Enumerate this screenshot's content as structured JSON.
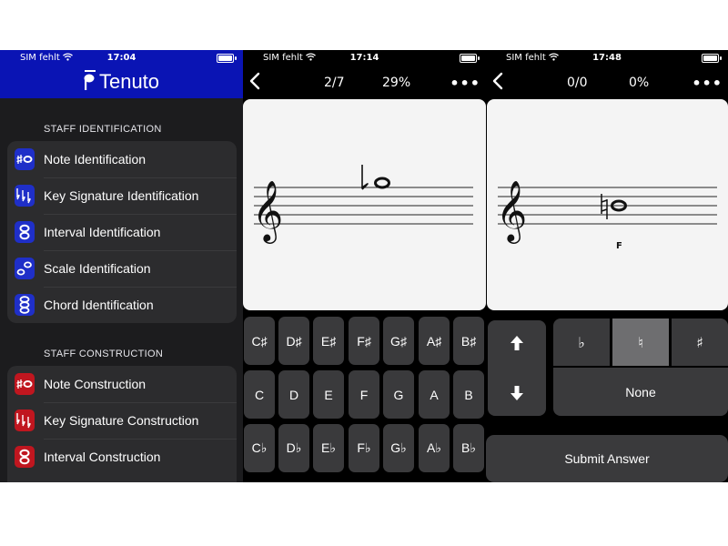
{
  "status_left": "SIM fehlt",
  "screens": [
    {
      "time": "17:04"
    },
    {
      "time": "17:14"
    },
    {
      "time": "17:48"
    }
  ],
  "menu": {
    "app_title": "Tenuto",
    "sections": [
      {
        "title": "STAFF IDENTIFICATION",
        "items": [
          {
            "label": "Note Identification",
            "icon": "note-sharp-icon"
          },
          {
            "label": "Key Signature Identification",
            "icon": "key-signature-flats-icon"
          },
          {
            "label": "Interval Identification",
            "icon": "interval-icon"
          },
          {
            "label": "Scale Identification",
            "icon": "scale-icon"
          },
          {
            "label": "Chord Identification",
            "icon": "chord-icon"
          }
        ]
      },
      {
        "title": "STAFF CONSTRUCTION",
        "items": [
          {
            "label": "Note Construction",
            "icon": "note-sharp-icon"
          },
          {
            "label": "Key Signature Construction",
            "icon": "key-signature-flats-icon"
          },
          {
            "label": "Interval Construction",
            "icon": "interval-icon"
          }
        ]
      }
    ],
    "colors": {
      "header": "#0a14b4",
      "ident_icon": "#1f2fc8",
      "constr_icon": "#c0161f"
    }
  },
  "exercise": {
    "progress": "2/7",
    "percent": "29%",
    "key_rows": [
      [
        "C♯",
        "D♯",
        "E♯",
        "F♯",
        "G♯",
        "A♯",
        "B♯"
      ],
      [
        "C",
        "D",
        "E",
        "F",
        "G",
        "A",
        "B"
      ],
      [
        "C♭",
        "D♭",
        "E♭",
        "F♭",
        "G♭",
        "A♭",
        "B♭"
      ]
    ]
  },
  "construction": {
    "score": "0/0",
    "percent": "0%",
    "note_label": "F",
    "accidentals": [
      "♭",
      "♮",
      "♯"
    ],
    "selected_accidental": "♮",
    "none_label": "None",
    "submit_label": "Submit Answer"
  }
}
